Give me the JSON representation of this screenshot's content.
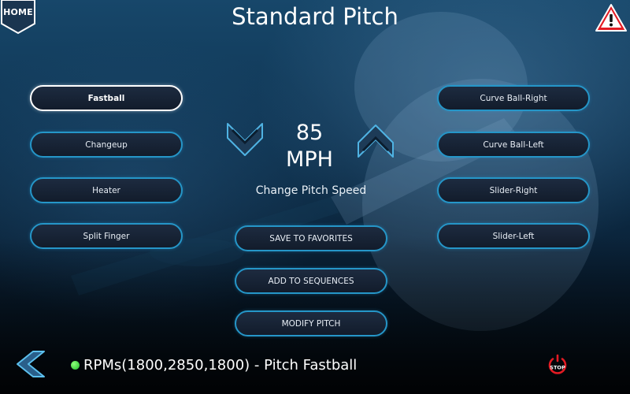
{
  "header": {
    "home_label": "HOME",
    "title": "Standard Pitch",
    "warning_icon": "warning-triangle-icon"
  },
  "pitches_left": [
    {
      "label": "Fastball",
      "selected": true
    },
    {
      "label": "Changeup",
      "selected": false
    },
    {
      "label": "Heater",
      "selected": false
    },
    {
      "label": "Split Finger",
      "selected": false
    }
  ],
  "pitches_right": [
    {
      "label": "Curve Ball-Right",
      "selected": false
    },
    {
      "label": "Curve Ball-Left",
      "selected": false
    },
    {
      "label": "Slider-Right",
      "selected": false
    },
    {
      "label": "Slider-Left",
      "selected": false
    }
  ],
  "speed": {
    "value": "85",
    "unit": "MPH",
    "caption": "Change Pitch Speed",
    "decrease_icon": "chevron-down-icon",
    "increase_icon": "chevron-up-icon"
  },
  "actions": {
    "save_favorites": "SAVE TO FAVORITES",
    "add_sequences": "ADD TO SEQUENCES",
    "modify_pitch": "MODIFY PITCH"
  },
  "footer": {
    "back_icon": "chevron-left-icon",
    "status_text": "RPMs(1800,2850,1800) - Pitch Fastball",
    "status_color": "#2ecc40",
    "stop_label": "STOP"
  },
  "colors": {
    "accent": "#2596c8",
    "warning": "#e31b23",
    "stop": "#e31b23"
  }
}
